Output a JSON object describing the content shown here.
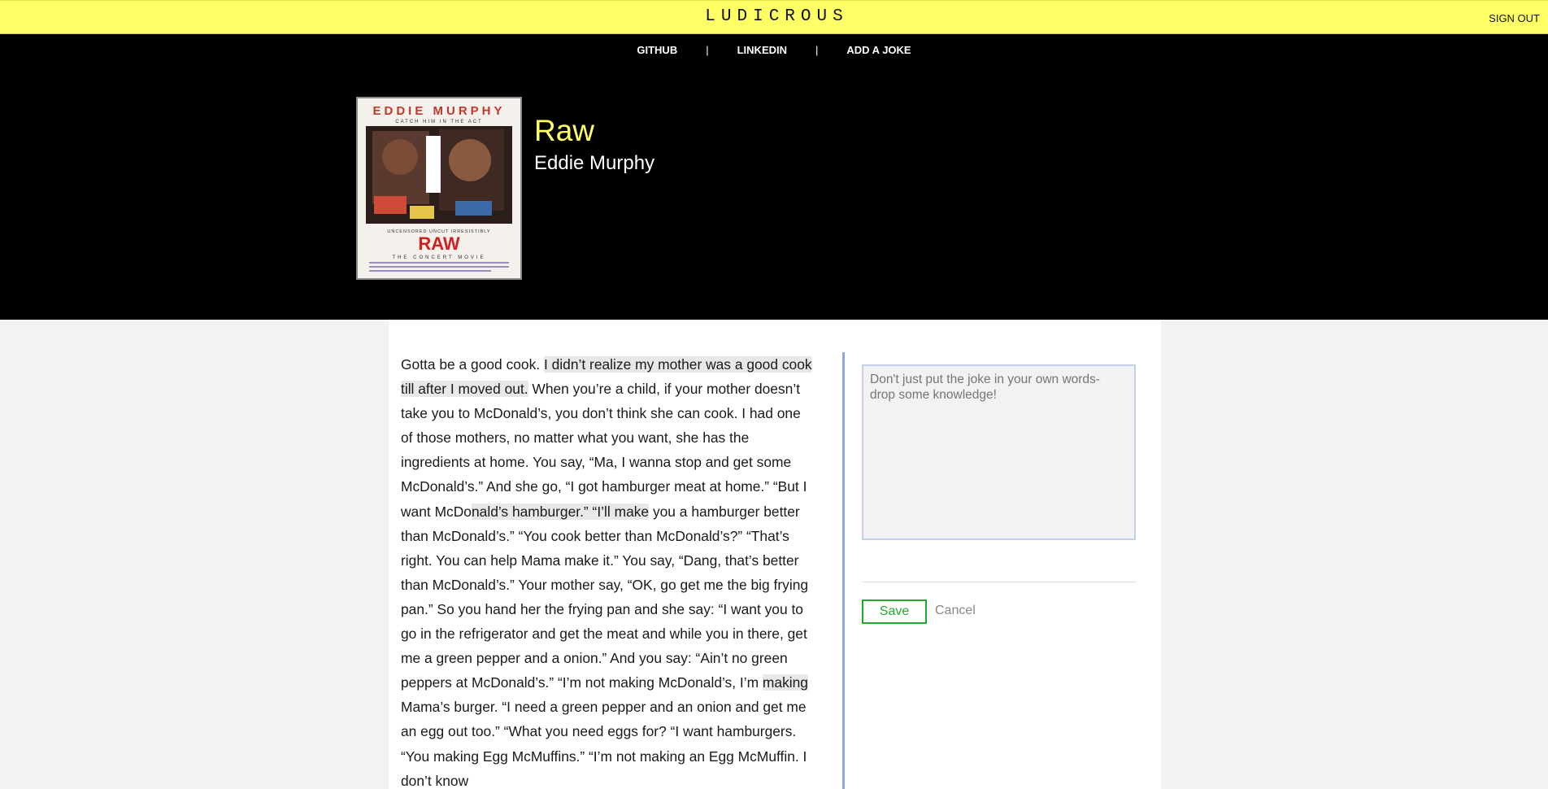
{
  "app": {
    "logo": "LUDICROUS",
    "sign_out": "SIGN OUT"
  },
  "nav": {
    "items": [
      "GITHUB",
      "LINKEDIN",
      "ADD A JOKE"
    ],
    "separator": "|"
  },
  "special": {
    "title": "Raw",
    "comedian": "Eddie Murphy",
    "poster": {
      "top_text": "EDDIE MURPHY",
      "tagline": "CATCH HIM IN THE ACT",
      "subtitle": "UNCENSORED UNCUT IRRESISTIBLY",
      "title": "RAW",
      "bottom": "THE CONCERT MOVIE"
    }
  },
  "joke": {
    "segments": [
      {
        "text": "Gotta be a good cook. ",
        "highlight": false
      },
      {
        "text": "I didn’t realize my mother was a good cook till after I moved out.",
        "highlight": true
      },
      {
        "text": " When you’re a child, if your mother doesn’t take you to McDonald’s, you don’t think she can cook. I had one of those mothers, no matter what you want, she has the ingredients at home. You say, “Ma, I wanna stop and get some McDonald’s.” And she go, “I got hamburger meat at home.” “But I want McDo",
        "highlight": false
      },
      {
        "text": "nald’s hamburger.” “I’ll make",
        "highlight": true
      },
      {
        "text": " you a hamburger better than McDonald’s.” “You cook better than McDonald’s?” “That’s right. You can help Mama make it.” You say, “Dang, that’s better than McDonald’s.” Your mother say, “OK, go get me the big frying pan.” So you hand her the frying pan and she say: “I want you to go in the refrigerator and get the meat and while you in there, get me a green pepper and a onion.” And you say: “Ain’t no green peppers at McDonald’s.” “I’m not making McDonald’s, I’m ",
        "highlight": false
      },
      {
        "text": "making",
        "highlight": true
      },
      {
        "text": " Mama’s burger. “I need a green pepper and an onion and get me an egg out too.” “What you need eggs for? “I want hamburgers. “You making Egg McMuffins.” “I’m not making an Egg McMuffin. I don’t know",
        "highlight": false
      }
    ]
  },
  "annotation": {
    "placeholder": "Don't just put the joke in your own words- drop some knowledge!",
    "save_label": "Save",
    "cancel_label": "Cancel"
  },
  "colors": {
    "topbar": "#ffff66",
    "title": "#ffff66",
    "save": "#1fae2b",
    "annotation_border": "#8fa6e4"
  }
}
